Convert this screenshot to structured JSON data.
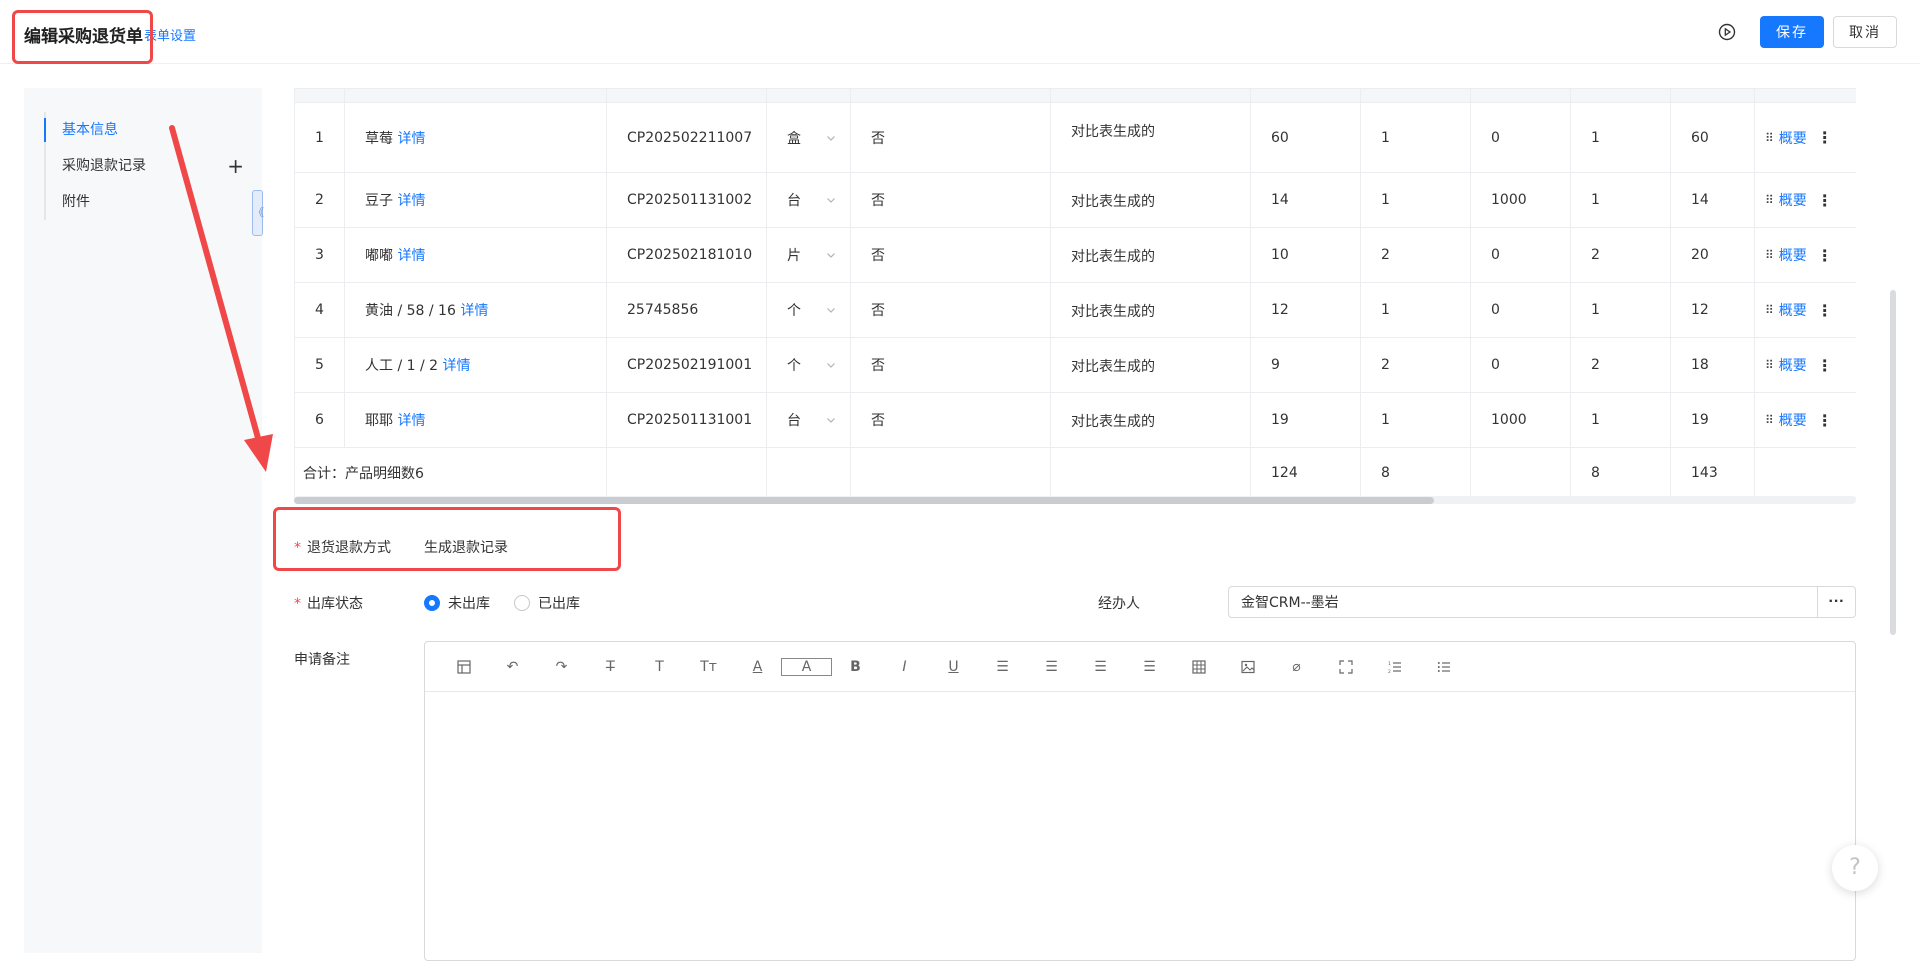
{
  "header": {
    "title": "编辑采购退货单",
    "form_settings": "表单设置",
    "save": "保存",
    "cancel": "取消"
  },
  "sidebar": {
    "items": [
      {
        "label": "基本信息",
        "active": true
      },
      {
        "label": "采购退款记录",
        "plus": "+"
      },
      {
        "label": "附件"
      }
    ],
    "collapse_glyph": "《"
  },
  "table": {
    "rows": [
      {
        "idx": "1",
        "name": "草莓",
        "detail": "详情",
        "code": "CP202502211007",
        "unit": "盒",
        "flag": "否",
        "note": "对比表生成的",
        "a": "60",
        "b": "1",
        "c": "0",
        "d": "1",
        "e": "60",
        "summary": "概要"
      },
      {
        "idx": "2",
        "name": "豆子",
        "detail": "详情",
        "code": "CP202501131002",
        "unit": "台",
        "flag": "否",
        "note": "对比表生成的",
        "a": "14",
        "b": "1",
        "c": "1000",
        "d": "1",
        "e": "14",
        "summary": "概要"
      },
      {
        "idx": "3",
        "name": "嘟嘟",
        "detail": "详情",
        "code": "CP202502181010",
        "unit": "片",
        "flag": "否",
        "note": "对比表生成的",
        "a": "10",
        "b": "2",
        "c": "0",
        "d": "2",
        "e": "20",
        "summary": "概要"
      },
      {
        "idx": "4",
        "name": "黄油 / 58 / 16",
        "detail": "详情",
        "code": "25745856",
        "unit": "个",
        "flag": "否",
        "note": "对比表生成的",
        "a": "12",
        "b": "1",
        "c": "0",
        "d": "1",
        "e": "12",
        "summary": "概要"
      },
      {
        "idx": "5",
        "name": "人工 / 1 / 2",
        "detail": "详情",
        "code": "CP202502191001",
        "unit": "个",
        "flag": "否",
        "note": "对比表生成的",
        "a": "9",
        "b": "2",
        "c": "0",
        "d": "2",
        "e": "18",
        "summary": "概要"
      },
      {
        "idx": "6",
        "name": "耶耶",
        "detail": "详情",
        "code": "CP202501131001",
        "unit": "台",
        "flag": "否",
        "note": "对比表生成的",
        "a": "19",
        "b": "1",
        "c": "1000",
        "d": "1",
        "e": "19",
        "summary": "概要"
      }
    ],
    "total": {
      "label": "合计：产品明细数6",
      "a": "124",
      "b": "8",
      "d": "8",
      "e": "143"
    }
  },
  "form": {
    "required_mark": "*",
    "refund_label": "退货退款方式",
    "refund_value": "生成退款记录",
    "out_label": "出库状态",
    "out_options": [
      "未出库",
      "已出库"
    ],
    "out_selected": "未出库",
    "handler_label": "经办人",
    "handler_value": "金智CRM--墨岩",
    "handler_btn": "···",
    "remark_label": "申请备注"
  },
  "toolbar": [
    {
      "icon": "table-format-icon"
    },
    {
      "icon": "undo-icon",
      "glyph": "↶"
    },
    {
      "icon": "redo-icon",
      "glyph": "↷"
    },
    {
      "icon": "strikethrough-icon",
      "glyph": "T̶"
    },
    {
      "icon": "font-size-icon",
      "glyph": "T"
    },
    {
      "icon": "heading-icon",
      "glyph": "Tт"
    },
    {
      "icon": "font-color-icon",
      "glyph": "A"
    },
    {
      "icon": "background-color-icon",
      "glyph": "A"
    },
    {
      "icon": "bold-icon",
      "glyph": "B"
    },
    {
      "icon": "italic-icon",
      "glyph": "I"
    },
    {
      "icon": "underline-icon",
      "glyph": "U"
    },
    {
      "icon": "align-left-icon",
      "glyph": "☰"
    },
    {
      "icon": "align-center-icon",
      "glyph": "☰"
    },
    {
      "icon": "align-right-icon",
      "glyph": "☰"
    },
    {
      "icon": "justify-icon",
      "glyph": "☰"
    },
    {
      "icon": "insert-table-icon"
    },
    {
      "icon": "insert-image-icon"
    },
    {
      "icon": "attachment-icon",
      "glyph": "⌀"
    },
    {
      "icon": "fullscreen-icon"
    },
    {
      "icon": "ordered-list-icon"
    },
    {
      "icon": "bullet-list-icon"
    }
  ],
  "help": {
    "glyph": "?"
  }
}
